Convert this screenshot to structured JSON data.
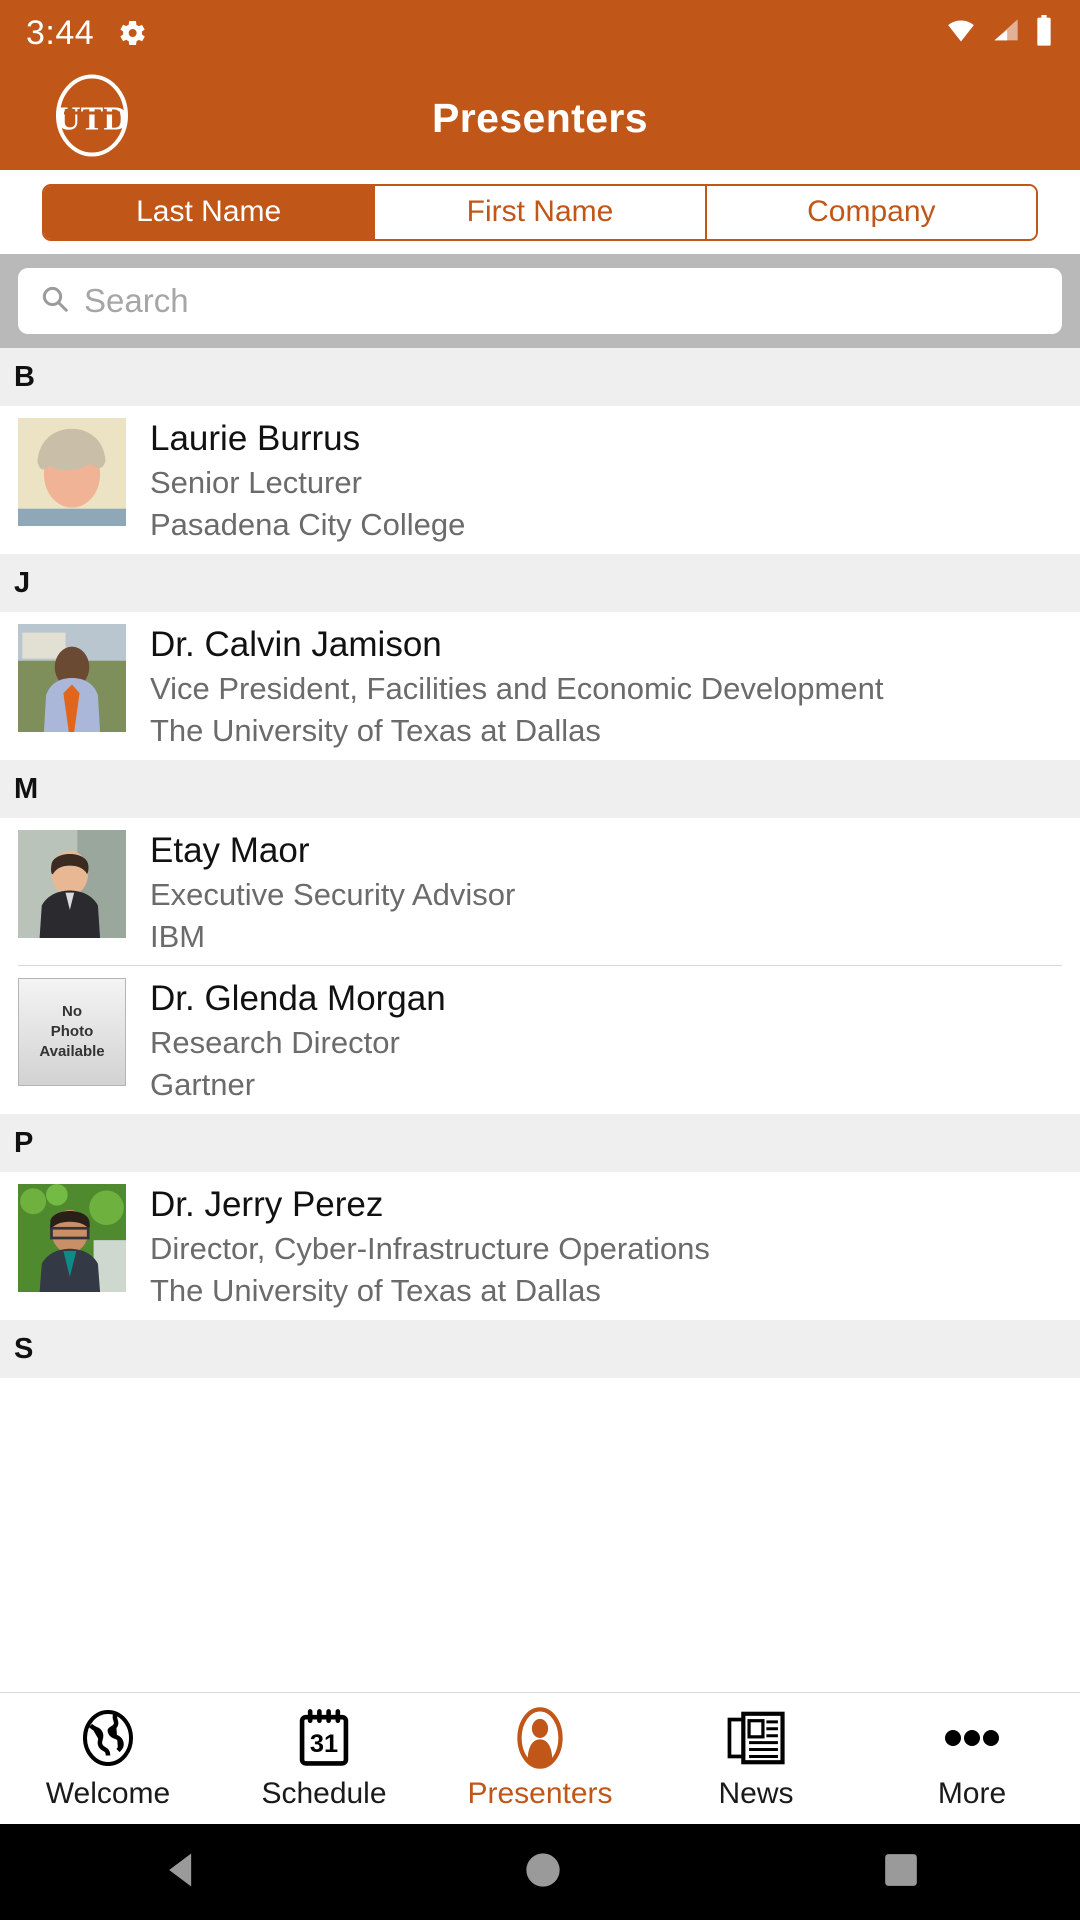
{
  "status_bar": {
    "time": "3:44",
    "icons": [
      "gear-icon",
      "wifi-icon",
      "cellular-signal-icon",
      "battery-icon"
    ]
  },
  "app_bar": {
    "title": "Presenters",
    "logo_alt": "UTD"
  },
  "segmented_control": {
    "options": [
      {
        "label": "Last Name",
        "selected": true
      },
      {
        "label": "First Name",
        "selected": false
      },
      {
        "label": "Company",
        "selected": false
      }
    ]
  },
  "search": {
    "placeholder": "Search",
    "value": "",
    "icon": "search-icon"
  },
  "list": {
    "sections": [
      {
        "letter": "B",
        "people": [
          {
            "name": "Laurie  Burrus",
            "title": "Senior Lecturer",
            "company": "Pasadena City College",
            "photo": "portrait-woman-blonde"
          }
        ]
      },
      {
        "letter": "J",
        "people": [
          {
            "name": "Dr. Calvin  Jamison",
            "title": "Vice President, Facilities and Economic Development",
            "company": "The University of Texas at Dallas",
            "photo": "portrait-man-orange-tie"
          }
        ]
      },
      {
        "letter": "M",
        "people": [
          {
            "name": "Etay  Maor",
            "title": "Executive Security Advisor",
            "company": "IBM",
            "photo": "portrait-man-suit"
          },
          {
            "name": "Dr. Glenda  Morgan",
            "title": "Research Director",
            "company": "Gartner",
            "photo": "no-photo-available",
            "photo_text": [
              "No",
              "Photo",
              "Available"
            ]
          }
        ]
      },
      {
        "letter": "P",
        "people": [
          {
            "name": "Dr. Jerry  Perez",
            "title": "Director, Cyber-Infrastructure Operations",
            "company": "The University of Texas at Dallas",
            "photo": "portrait-man-glasses-green"
          }
        ]
      },
      {
        "letter": "S",
        "people": []
      }
    ]
  },
  "tab_bar": {
    "tabs": [
      {
        "label": "Welcome",
        "icon": "globe-icon",
        "active": false
      },
      {
        "label": "Schedule",
        "icon": "calendar-31-icon",
        "active": false
      },
      {
        "label": "Presenters",
        "icon": "person-icon",
        "active": true
      },
      {
        "label": "News",
        "icon": "newspaper-icon",
        "active": false
      },
      {
        "label": "More",
        "icon": "ellipsis-icon",
        "active": false
      }
    ]
  },
  "android_nav": {
    "buttons": [
      "back-triangle-icon",
      "home-circle-icon",
      "recents-square-icon"
    ]
  },
  "colors": {
    "brand_orange": "#c05617",
    "section_gray": "#efefef",
    "search_band": "#b9b9b9",
    "subtitle_gray": "#6b6b6b"
  }
}
